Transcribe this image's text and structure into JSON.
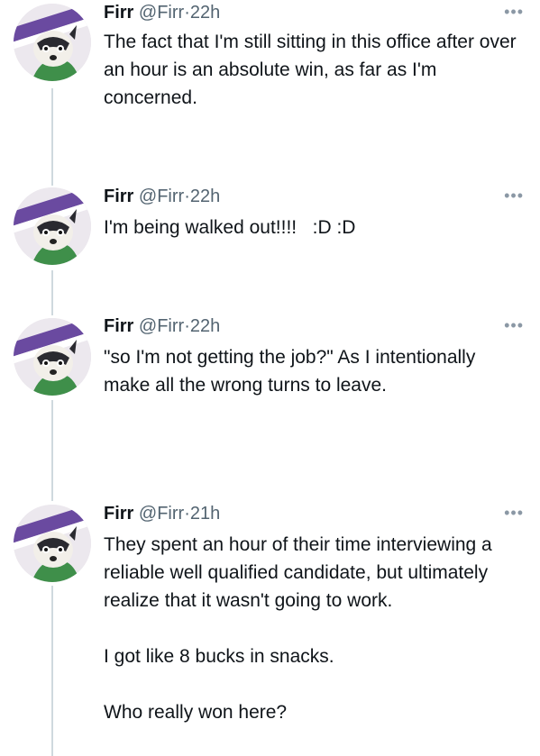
{
  "tweets": [
    {
      "name": "Firr",
      "handle": "@Firr",
      "separator": "·",
      "time": "22h",
      "more_icon": "more-horizontal-icon",
      "text": [
        "The fact that I'm still sitting in this office after over an hour is an absolute win, as far as I'm concerned."
      ]
    },
    {
      "name": "Firr",
      "handle": "@Firr",
      "separator": "·",
      "time": "22h",
      "more_icon": "more-horizontal-icon",
      "text": [
        "I'm being walked out!!!!   :D :D"
      ]
    },
    {
      "name": "Firr",
      "handle": "@Firr",
      "separator": "·",
      "time": "22h",
      "more_icon": "more-horizontal-icon",
      "text": [
        "\"so I'm not getting the job?\" As I intentionally make all the wrong turns to leave."
      ]
    },
    {
      "name": "Firr",
      "handle": "@Firr",
      "separator": "·",
      "time": "21h",
      "more_icon": "more-horizontal-icon",
      "text": [
        "They spent an hour of their time interviewing a reliable well qualified candidate, but ultimately realize that it wasn't going to work.",
        "I got like 8 bucks in snacks.",
        "Who really won here?"
      ]
    }
  ],
  "colors": {
    "text": "#0f1419",
    "secondary": "#536471",
    "thread_line": "#cfd9de"
  }
}
